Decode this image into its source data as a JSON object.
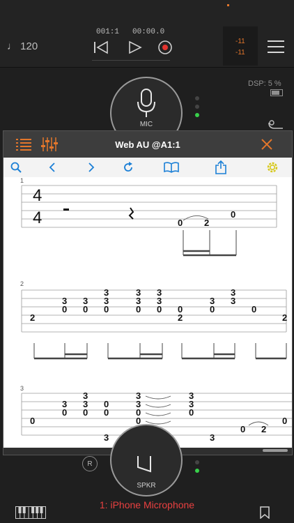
{
  "transport": {
    "tempo": "♩ 120",
    "position": "001:1",
    "time": "00:00.0"
  },
  "meter": {
    "left": "-11",
    "right": "-11"
  },
  "dsp": "DSP: 5 %",
  "mic_label": "MIC",
  "spkr_label": "SPKR",
  "r_label": "R",
  "device": "1: iPhone Microphone",
  "panel_title": "Web AU @A1:1",
  "icons": {
    "list": "list-icon",
    "mixer": "mixer-icon",
    "close": "close-icon",
    "search": "search-icon",
    "back": "chevron-left-icon",
    "forward": "chevron-right-icon",
    "reload": "reload-icon",
    "bookmarks": "book-icon",
    "share": "share-icon",
    "settings": "gear-icon"
  },
  "colors": {
    "accent": "#e3762b",
    "link": "#1a7fd6",
    "gear": "#d6c81a",
    "device": "#e94040"
  },
  "score": {
    "systems": [
      {
        "number": "1",
        "time_sig": [
          "4",
          "4"
        ]
      },
      {
        "number": "2"
      },
      {
        "number": "3"
      }
    ]
  }
}
